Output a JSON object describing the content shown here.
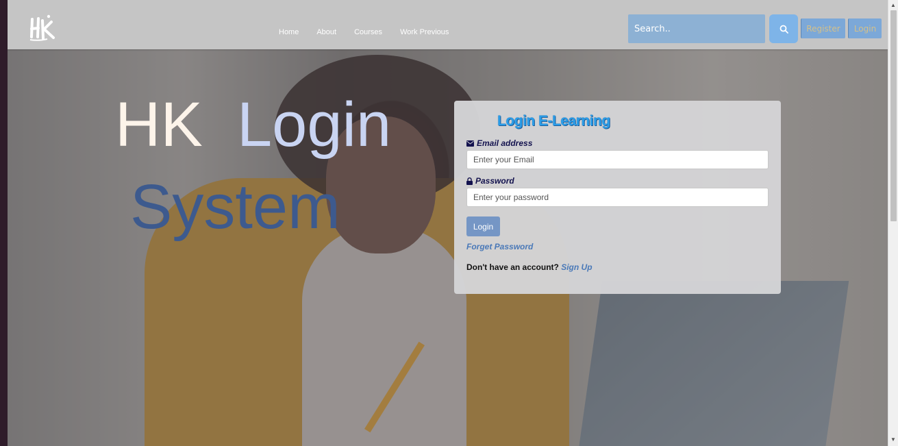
{
  "navbar": {
    "logo_text": "HK",
    "links": [
      "Home",
      "About",
      "Courses",
      "Work Previous"
    ],
    "search_placeholder": "Search..",
    "register_label": "Register",
    "login_label": "Login"
  },
  "hero": {
    "title_word1": "HK",
    "title_word2": "Login",
    "title_word3": "System"
  },
  "login_card": {
    "title": "Login E-Learning",
    "email_label": "Email address",
    "email_placeholder": "Enter your Email",
    "password_label": "Password",
    "password_placeholder": "Enter your password",
    "submit_label": "Login",
    "forget_label": "Forget Password",
    "no_account_text": "Don't have an account?",
    "signup_label": "Sign Up"
  },
  "colors": {
    "navbar_bg": "#c5c5c5",
    "search_bg": "#8db1d4",
    "accent_blue": "#7eb4e8",
    "card_bg": "#d4d4d6",
    "title_blue": "#2b9de8",
    "system_blue": "#3d5a8e"
  },
  "icons": {
    "search": "search-icon",
    "email": "envelope-icon",
    "password": "lock-icon"
  }
}
